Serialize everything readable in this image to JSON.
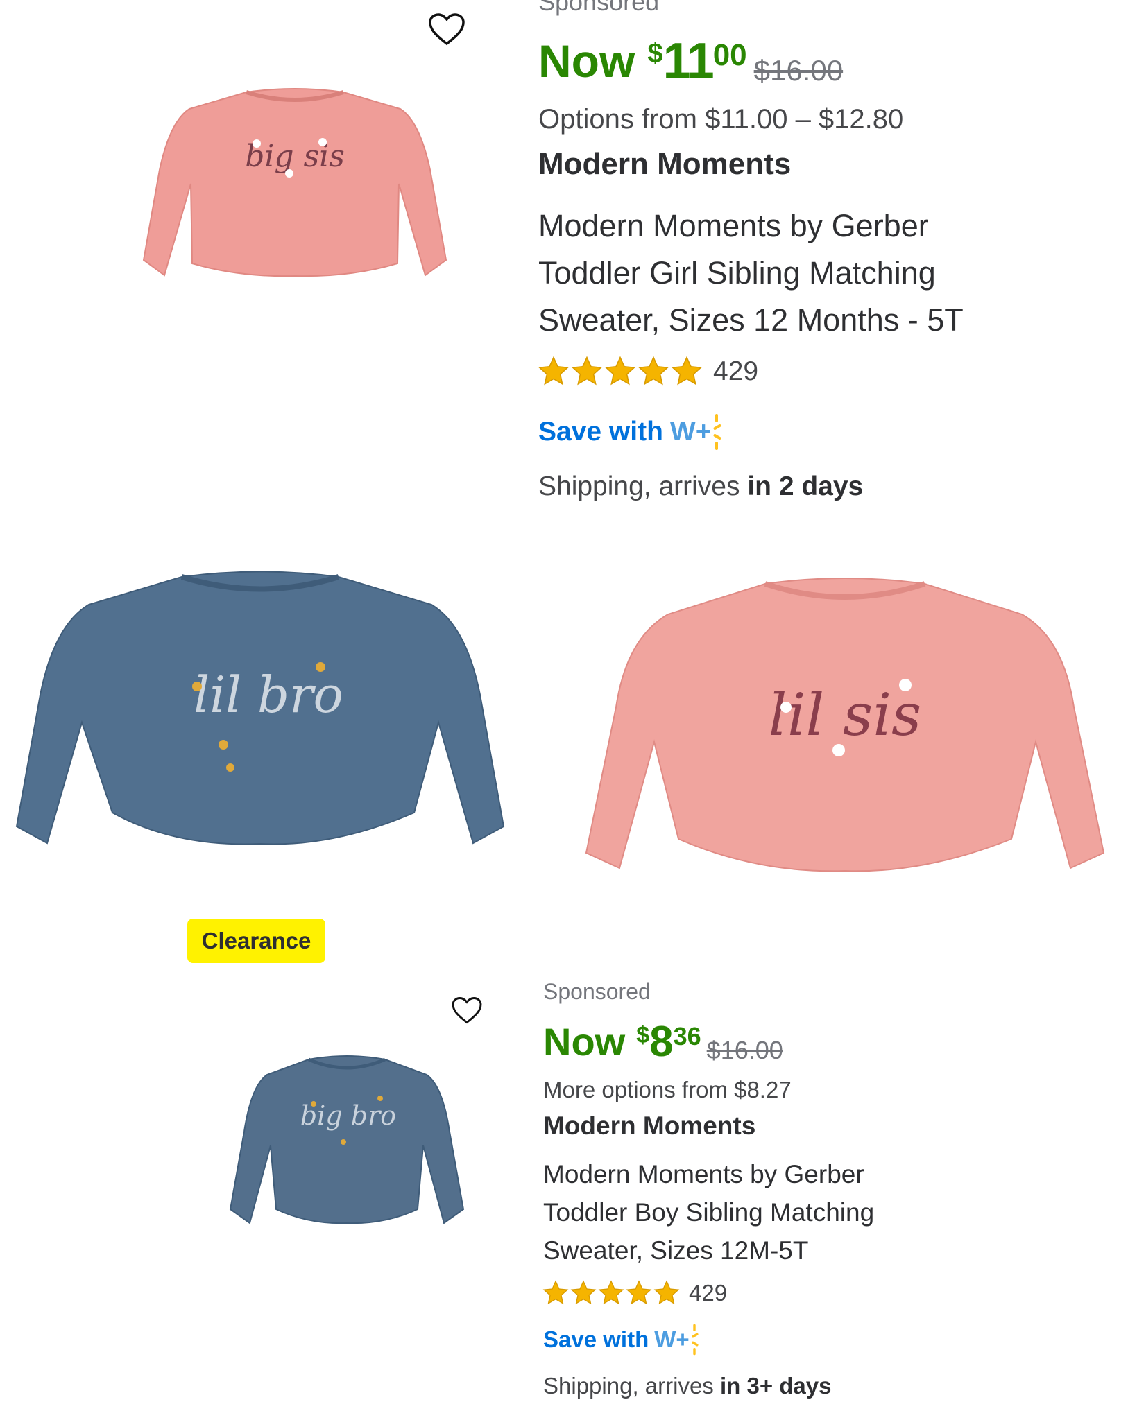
{
  "colors": {
    "price_green": "#2a8703",
    "walmart_blue": "#0071dc",
    "spark_yellow": "#ffc220",
    "clearance_yellow": "#fff200",
    "star_gold": "#f5b400"
  },
  "product_1": {
    "sponsored": "Sponsored",
    "now_label": "Now",
    "currency": "$",
    "price_dollars": "11",
    "price_cents": "00",
    "was_price": "$16.00",
    "options": "Options from $11.00 – $12.80",
    "brand": "Modern Moments",
    "title_line1": "Modern Moments by Gerber",
    "title_line2": "Toddler Girl Sibling Matching",
    "title_line3": "Sweater, Sizes 12 Months - 5T",
    "rating": 5,
    "review_count": "429",
    "save_with": "Save with",
    "wplus": "W+",
    "shipping_prefix": "Shipping, arrives",
    "shipping_days": "in 2 days",
    "image_text": "big sis",
    "favorite_icon": "heart-outline-icon"
  },
  "product_1_variant_images": [
    {
      "image_text": "lil bro"
    },
    {
      "image_text": "lil sis"
    }
  ],
  "product_2": {
    "badge": "Clearance",
    "sponsored": "Sponsored",
    "now_label": "Now",
    "currency": "$",
    "price_dollars": "8",
    "price_cents": "36",
    "was_price": "$16.00",
    "options": "More options from $8.27",
    "brand": "Modern Moments",
    "title_line1": "Modern Moments by Gerber",
    "title_line2": "Toddler Boy Sibling Matching",
    "title_line3": "Sweater, Sizes 12M-5T",
    "rating": 5,
    "review_count": "429",
    "save_with": "Save with",
    "wplus": "W+",
    "shipping_prefix": "Shipping, arrives",
    "shipping_days": "in 3+ days",
    "image_text": "big bro",
    "favorite_icon": "heart-outline-icon"
  }
}
